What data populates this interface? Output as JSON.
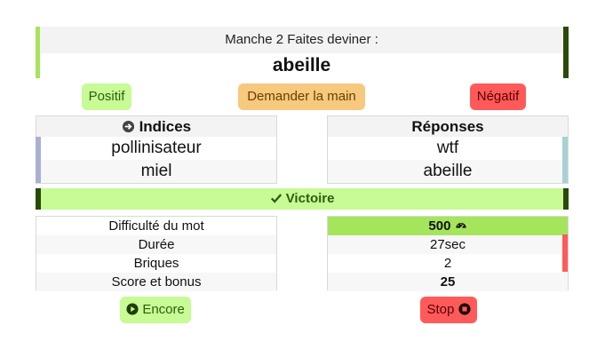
{
  "header": {
    "round_title": "Manche 2 Faites deviner :",
    "word": "abeille"
  },
  "actions": {
    "positive": "Positif",
    "ask_hand": "Demander la main",
    "negative": "Négatif"
  },
  "clues": {
    "title": "Indices",
    "items": [
      "pollinisateur",
      "miel"
    ]
  },
  "answers": {
    "title": "Réponses",
    "items": [
      "wtf",
      "abeille"
    ]
  },
  "result": {
    "label": "Victoire"
  },
  "stats": {
    "labels": [
      "Difficulté du mot",
      "Durée",
      "Briques",
      "Score et bonus"
    ],
    "values": [
      "500",
      "27sec",
      "2",
      "25"
    ]
  },
  "footer": {
    "again": "Encore",
    "stop": "Stop"
  },
  "colors": {
    "green": "#c8fa96",
    "accent_green": "#a5e55c",
    "dark_green": "#2a4a07",
    "orange": "#f6c97f",
    "red": "#ff5a5a"
  },
  "icons": {
    "clues": "arrow-circle-icon",
    "result": "check-icon",
    "difficulty": "gauge-icon",
    "again": "play-circle-icon",
    "stop": "stop-circle-icon"
  }
}
